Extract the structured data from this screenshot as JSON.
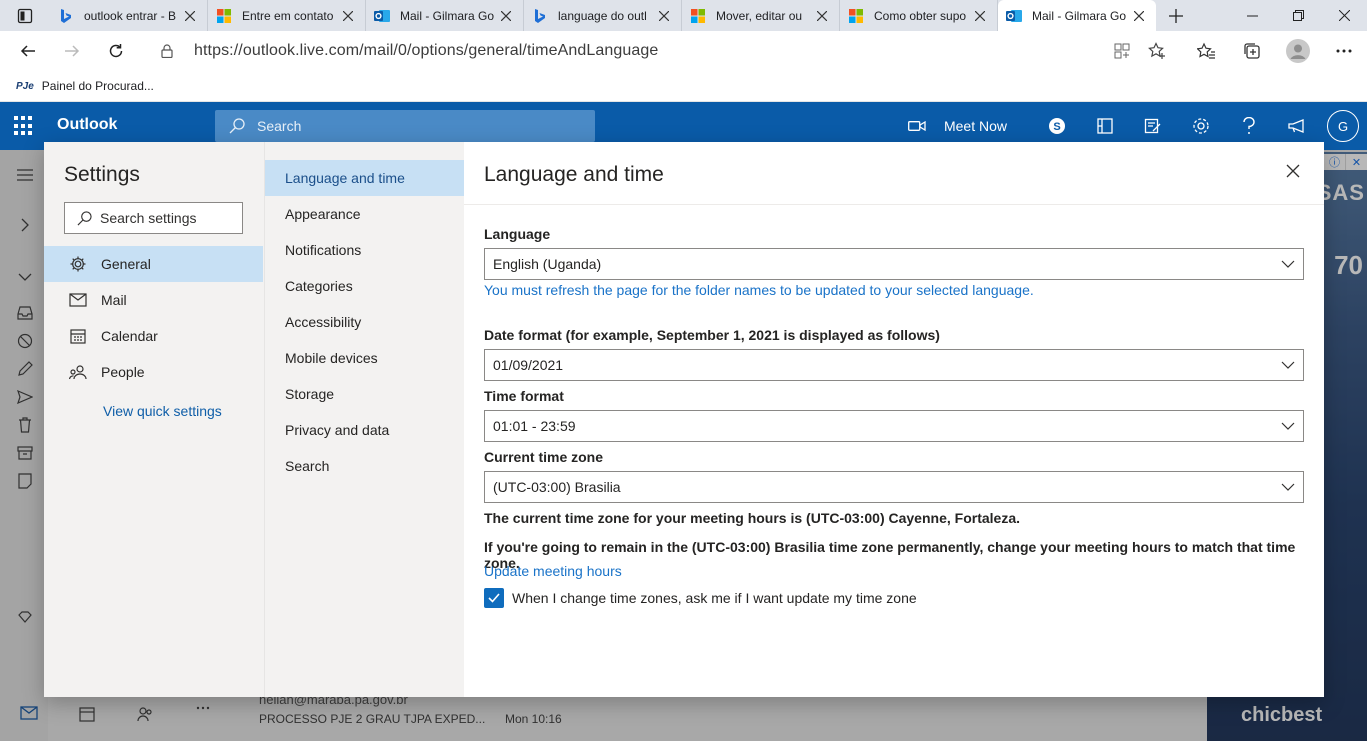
{
  "browser": {
    "tabs": [
      {
        "title": "outlook entrar - B",
        "icon": "bing-icon"
      },
      {
        "title": "Entre em contato",
        "icon": "microsoft-icon"
      },
      {
        "title": "Mail - Gilmara Go",
        "icon": "outlook-icon"
      },
      {
        "title": "language do outl",
        "icon": "bing-icon"
      },
      {
        "title": "Mover, editar ou",
        "icon": "microsoft-icon"
      },
      {
        "title": "Como obter supo",
        "icon": "microsoft-icon"
      },
      {
        "title": "Mail - Gilmara Go",
        "icon": "outlook-icon"
      }
    ],
    "active_tab_index": 6,
    "url": "https://outlook.live.com/mail/0/options/general/timeAndLanguage",
    "favorites": [
      {
        "prefix": "PJe",
        "label": "Painel do Procurad..."
      }
    ]
  },
  "outlook_header": {
    "brand": "Outlook",
    "search_placeholder": "Search",
    "meet_now": "Meet Now",
    "avatar_initial": "G",
    "color": "#0a5ba8"
  },
  "background": {
    "mail_sender": "neilan@maraba.pa.gov.br",
    "mail_subject": "PROCESSO PJE 2 GRAU TJPA EXPED...",
    "mail_time": "Mon 10:16",
    "ad_brand": "chicbest",
    "ad_text_1": "SAS",
    "ad_text_2": "70"
  },
  "settings": {
    "title": "Settings",
    "search_placeholder": "Search settings",
    "categories": [
      {
        "label": "General",
        "icon": "gear-icon",
        "selected": true
      },
      {
        "label": "Mail",
        "icon": "mail-icon",
        "selected": false
      },
      {
        "label": "Calendar",
        "icon": "calendar-icon",
        "selected": false
      },
      {
        "label": "People",
        "icon": "people-icon",
        "selected": false
      }
    ],
    "quick_settings_link": "View quick settings",
    "subcategories": [
      {
        "label": "Language and time",
        "selected": true
      },
      {
        "label": "Appearance",
        "selected": false
      },
      {
        "label": "Notifications",
        "selected": false
      },
      {
        "label": "Categories",
        "selected": false
      },
      {
        "label": "Accessibility",
        "selected": false
      },
      {
        "label": "Mobile devices",
        "selected": false
      },
      {
        "label": "Storage",
        "selected": false
      },
      {
        "label": "Privacy and data",
        "selected": false
      },
      {
        "label": "Search",
        "selected": false
      }
    ]
  },
  "language_time": {
    "title": "Language and time",
    "language_label": "Language",
    "language_value": "English (Uganda)",
    "language_note": "You must refresh the page for the folder names to be updated to your selected language.",
    "date_format_label": "Date format (for example, September 1, 2021 is displayed as follows)",
    "date_format_value": "01/09/2021",
    "time_format_label": "Time format",
    "time_format_value": "01:01 - 23:59",
    "time_zone_label": "Current time zone",
    "time_zone_value": "(UTC-03:00) Brasilia",
    "meeting_hours_note": "The current time zone for your meeting hours is (UTC-03:00) Cayenne, Fortaleza.",
    "remain_note": "If you're going to remain in the (UTC-03:00) Brasilia time zone permanently, change your meeting hours to match that time zone.",
    "update_link": "Update meeting hours",
    "checkbox_label": "When I change time zones, ask me if I want update my time zone",
    "checkbox_checked": true
  }
}
